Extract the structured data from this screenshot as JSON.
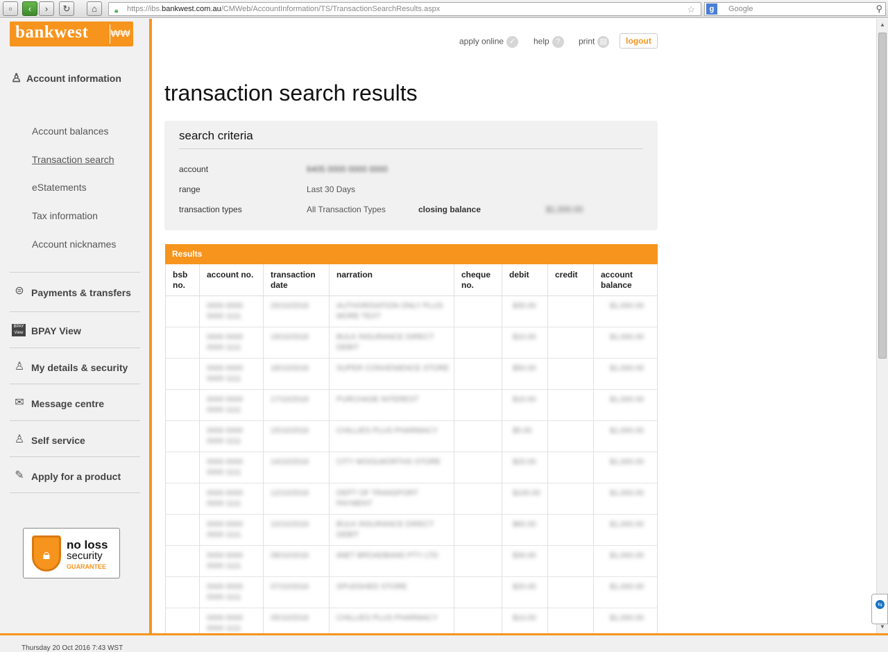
{
  "browser": {
    "url_prefix": "https://ibs.",
    "url_host": "bankwest.com.au",
    "url_path": "/CMWeb/AccountInformation/TS/TransactionSearchResults.aspx",
    "search_placeholder": "Google",
    "icons": [
      "back-icon",
      "forward-icon",
      "reload-icon",
      "home-icon",
      "lock-icon",
      "star-icon",
      "search-icon"
    ]
  },
  "logo": {
    "text": "bankwest",
    "mark": "₩₩"
  },
  "sidebar": {
    "header": "Account information",
    "subitems": [
      "Account balances",
      "Transaction search",
      "eStatements",
      "Tax information",
      "Account nicknames"
    ],
    "active_subitem": "Transaction search",
    "sections": [
      {
        "label": "Payments & transfers",
        "icon": "dollar-arrows-icon"
      },
      {
        "label": "BPAY View",
        "icon": "bpay-view-icon"
      },
      {
        "label": "My details & security",
        "icon": "person-icon"
      },
      {
        "label": "Message centre",
        "icon": "envelope-icon"
      },
      {
        "label": "Self service",
        "icon": "person-gear-icon"
      },
      {
        "label": "Apply for a product",
        "icon": "form-pen-icon"
      }
    ],
    "badge": {
      "line1": "no loss",
      "line2": "security",
      "line3": "GUARANTEE"
    }
  },
  "toplinks": {
    "apply": "apply online",
    "help": "help",
    "print": "print",
    "logout": "logout"
  },
  "page_title": "transaction search results",
  "criteria": {
    "title": "search criteria",
    "account_label": "account",
    "account_value": "6405 0000 0000 0000",
    "range_label": "range",
    "range_value": "Last 30 Days",
    "types_label": "transaction types",
    "types_value": "All Transaction Types",
    "closing_label": "closing balance",
    "closing_value": "$1,000.00"
  },
  "results": {
    "title": "Results",
    "headers": [
      "bsb no.",
      "account no.",
      "transaction date",
      "narration",
      "cheque no.",
      "debit",
      "credit",
      "account balance"
    ],
    "rows": [
      {
        "acct": "0000 0000 0000 1111",
        "date": "20/10/2016",
        "narr": "AUTHORISATION ONLY PLUS MORE TEXT",
        "debit": "$30.00",
        "bal": "$1,000.00"
      },
      {
        "acct": "0000 0000 0000 1111",
        "date": "19/10/2016",
        "narr": "BULK INSURANCE DIRECT DEBIT",
        "debit": "$10.00",
        "bal": "$1,000.00"
      },
      {
        "acct": "0000 0000 0000 1111",
        "date": "18/10/2016",
        "narr": "SUPER CONVENIENCE STORE",
        "debit": "$50.00",
        "bal": "$1,000.00"
      },
      {
        "acct": "0000 0000 0000 1111",
        "date": "17/10/2016",
        "narr": "PURCHASE INTEREST",
        "debit": "$10.00",
        "bal": "$1,000.00"
      },
      {
        "acct": "0000 0000 0000 1111",
        "date": "15/10/2016",
        "narr": "CHILLIES PLUS PHARMACY",
        "debit": "$5.00",
        "bal": "$1,000.00"
      },
      {
        "acct": "0000 0000 0000 1111",
        "date": "14/10/2016",
        "narr": "CITY WOOLWORTHS STORE",
        "debit": "$20.00",
        "bal": "$1,000.00"
      },
      {
        "acct": "0000 0000 0000 1111",
        "date": "12/10/2016",
        "narr": "DEPT OF TRANSPORT PAYMENT",
        "debit": "$100.00",
        "bal": "$1,000.00"
      },
      {
        "acct": "0000 0000 0000 1111",
        "date": "10/10/2016",
        "narr": "BULK INSURANCE DIRECT DEBIT",
        "debit": "$60.00",
        "bal": "$1,000.00"
      },
      {
        "acct": "0000 0000 0000 1111",
        "date": "08/10/2016",
        "narr": "iiNET BROADBAND PTY LTD",
        "debit": "$30.00",
        "bal": "$1,000.00"
      },
      {
        "acct": "0000 0000 0000 1111",
        "date": "07/10/2016",
        "narr": "SPUDSHED STORE",
        "debit": "$20.00",
        "bal": "$1,000.00"
      },
      {
        "acct": "0000 0000 0000 1111",
        "date": "05/10/2016",
        "narr": "CHILLIES PLUS PHARMACY",
        "debit": "$10.00",
        "bal": "$1,000.00"
      }
    ]
  },
  "status": "Thursday 20 Oct 2016 7:43 WST",
  "colors": {
    "brand": "#f7941d",
    "sidebar_bg": "#f1f1f1"
  }
}
